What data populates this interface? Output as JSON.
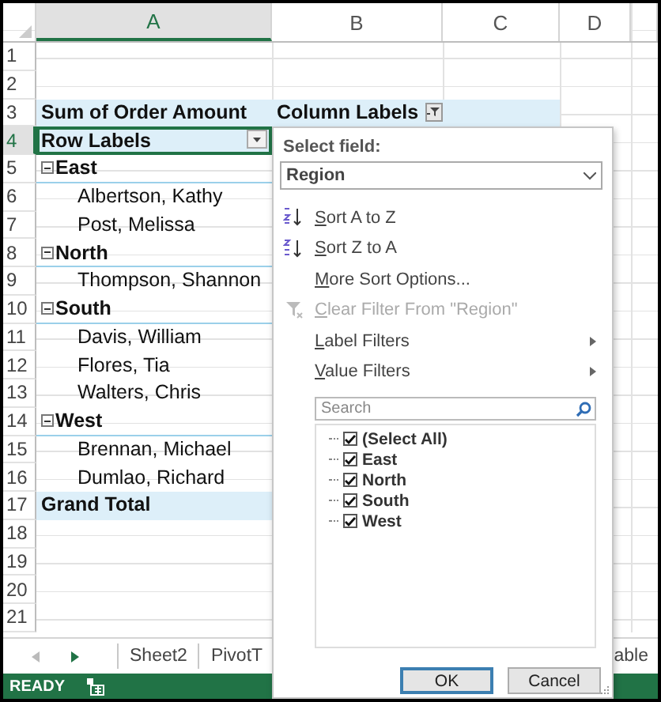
{
  "columns": [
    {
      "label": "A",
      "selected": true
    },
    {
      "label": "B",
      "selected": false
    },
    {
      "label": "C",
      "selected": false
    },
    {
      "label": "D",
      "selected": false
    }
  ],
  "rows": [
    {
      "number": "1",
      "kind": "empty"
    },
    {
      "number": "2",
      "kind": "empty"
    },
    {
      "number": "3",
      "kind": "header",
      "value_label": "Sum of Order Amount",
      "column_label": "Column Labels"
    },
    {
      "number": "4",
      "kind": "row-labels",
      "label": "Row Labels",
      "selected": true
    },
    {
      "number": "5",
      "kind": "group",
      "label": "East",
      "expanded": true
    },
    {
      "number": "6",
      "kind": "item",
      "label": "Albertson, Kathy"
    },
    {
      "number": "7",
      "kind": "item",
      "label": "Post, Melissa"
    },
    {
      "number": "8",
      "kind": "group",
      "label": "North",
      "expanded": true
    },
    {
      "number": "9",
      "kind": "item",
      "label": "Thompson, Shannon"
    },
    {
      "number": "10",
      "kind": "group",
      "label": "South",
      "expanded": true
    },
    {
      "number": "11",
      "kind": "item",
      "label": "Davis, William"
    },
    {
      "number": "12",
      "kind": "item",
      "label": "Flores, Tia"
    },
    {
      "number": "13",
      "kind": "item",
      "label": "Walters, Chris"
    },
    {
      "number": "14",
      "kind": "group",
      "label": "West",
      "expanded": true
    },
    {
      "number": "15",
      "kind": "item",
      "label": "Brennan, Michael"
    },
    {
      "number": "16",
      "kind": "item",
      "label": "Dumlao, Richard"
    },
    {
      "number": "17",
      "kind": "total",
      "label": "Grand Total"
    },
    {
      "number": "18",
      "kind": "empty"
    },
    {
      "number": "19",
      "kind": "empty"
    },
    {
      "number": "20",
      "kind": "empty"
    },
    {
      "number": "21",
      "kind": "empty"
    }
  ],
  "filter_popup": {
    "select_field_label": "Select field:",
    "select_field_value": "Region",
    "menu": [
      {
        "kind": "sort-asc",
        "label": "Sort A to Z",
        "disabled": false
      },
      {
        "kind": "sort-desc",
        "label": "Sort Z to A",
        "disabled": false
      },
      {
        "kind": "plain",
        "label": "More Sort Options...",
        "disabled": false
      },
      {
        "kind": "clear",
        "label": "Clear Filter From \"Region\"",
        "disabled": true
      },
      {
        "kind": "submenu",
        "label": "Label Filters",
        "disabled": false
      },
      {
        "kind": "submenu",
        "label": "Value Filters",
        "disabled": false
      }
    ],
    "search": {
      "placeholder": "Search"
    },
    "values": [
      {
        "label": "(Select All)",
        "checked": true
      },
      {
        "label": "East",
        "checked": true
      },
      {
        "label": "North",
        "checked": true
      },
      {
        "label": "South",
        "checked": true
      },
      {
        "label": "West",
        "checked": true
      }
    ],
    "buttons": [
      {
        "label": "OK",
        "selected": true
      },
      {
        "label": "Cancel",
        "selected": false
      }
    ]
  },
  "sheet_tabs": [
    {
      "label": "Sheet2"
    },
    {
      "label": "PivotT"
    }
  ],
  "sheet_tabs_right": [
    {
      "label": "able"
    }
  ],
  "status_bar": {
    "mode": "READY"
  }
}
